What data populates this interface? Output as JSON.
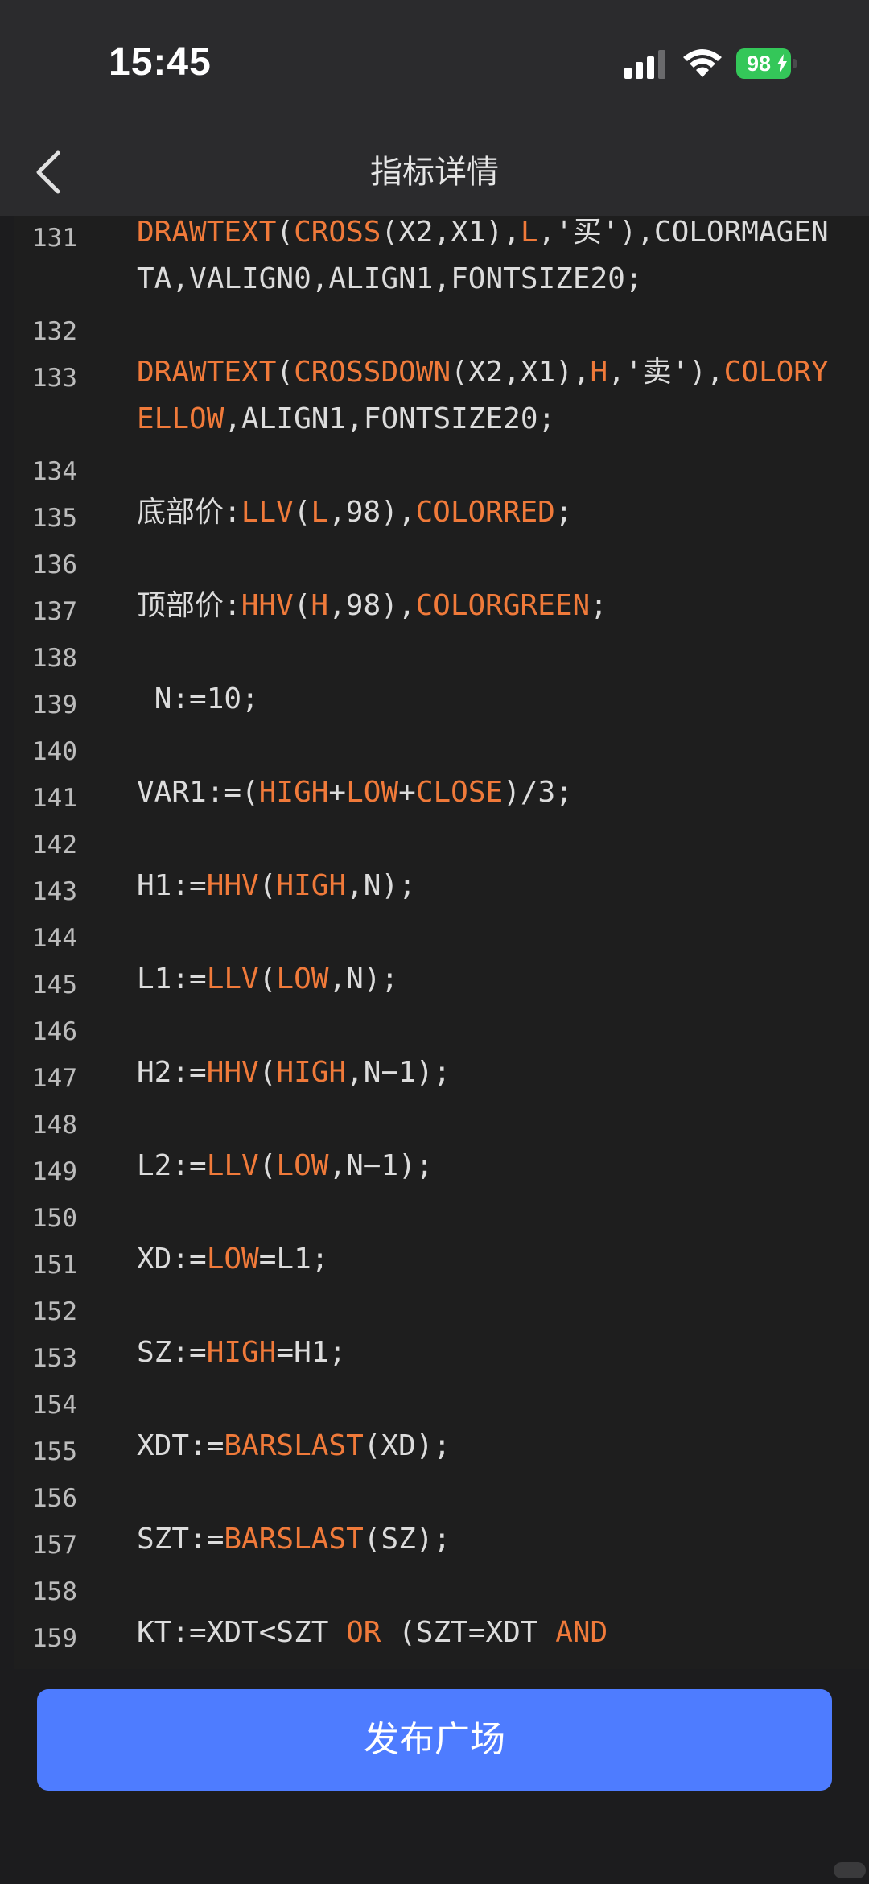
{
  "status_bar": {
    "time": "15:45",
    "battery_level": "98",
    "icons": [
      "signal-icon",
      "wifi-icon",
      "battery-icon",
      "charging-bolt-icon"
    ]
  },
  "nav": {
    "title": "指标详情",
    "back_icon": "chevron-left-icon"
  },
  "code": {
    "lines": [
      {
        "no": "131",
        "segments": [
          {
            "t": "DRAWTEXT",
            "k": 1
          },
          {
            "t": "("
          },
          {
            "t": "CROSS",
            "k": 1
          },
          {
            "t": "(X2,X1),"
          },
          {
            "t": "L",
            "k": 1
          },
          {
            "t": ",'买'),COLORMAGENTA,VALIGN0,ALIGN1,FONTSIZE20;"
          }
        ]
      },
      {
        "no": "132",
        "segments": []
      },
      {
        "no": "133",
        "segments": [
          {
            "t": "DRAWTEXT",
            "k": 1
          },
          {
            "t": "("
          },
          {
            "t": "CROSSDOWN",
            "k": 1
          },
          {
            "t": "(X2,X1),"
          },
          {
            "t": "H",
            "k": 1
          },
          {
            "t": ",'卖'),"
          },
          {
            "t": "COLORYELLOW",
            "k": 1
          },
          {
            "t": ",ALIGN1,FONTSIZE20;"
          }
        ]
      },
      {
        "no": "134",
        "segments": []
      },
      {
        "no": "135",
        "segments": [
          {
            "t": "底部价:"
          },
          {
            "t": "LLV",
            "k": 1
          },
          {
            "t": "("
          },
          {
            "t": "L",
            "k": 1
          },
          {
            "t": ",98),"
          },
          {
            "t": "COLORRED",
            "k": 1
          },
          {
            "t": ";"
          }
        ]
      },
      {
        "no": "136",
        "segments": []
      },
      {
        "no": "137",
        "segments": [
          {
            "t": "顶部价:"
          },
          {
            "t": "HHV",
            "k": 1
          },
          {
            "t": "("
          },
          {
            "t": "H",
            "k": 1
          },
          {
            "t": ",98),"
          },
          {
            "t": "COLORGREEN",
            "k": 1
          },
          {
            "t": ";"
          }
        ]
      },
      {
        "no": "138",
        "segments": []
      },
      {
        "no": "139",
        "segments": [
          {
            "t": " N:=10;"
          }
        ]
      },
      {
        "no": "140",
        "segments": []
      },
      {
        "no": "141",
        "segments": [
          {
            "t": "VAR1:=("
          },
          {
            "t": "HIGH",
            "k": 1
          },
          {
            "t": "+"
          },
          {
            "t": "LOW",
            "k": 1
          },
          {
            "t": "+"
          },
          {
            "t": "CLOSE",
            "k": 1
          },
          {
            "t": ")/3;"
          }
        ]
      },
      {
        "no": "142",
        "segments": []
      },
      {
        "no": "143",
        "segments": [
          {
            "t": "H1:="
          },
          {
            "t": "HHV",
            "k": 1
          },
          {
            "t": "("
          },
          {
            "t": "HIGH",
            "k": 1
          },
          {
            "t": ",N);"
          }
        ]
      },
      {
        "no": "144",
        "segments": []
      },
      {
        "no": "145",
        "segments": [
          {
            "t": "L1:="
          },
          {
            "t": "LLV",
            "k": 1
          },
          {
            "t": "("
          },
          {
            "t": "LOW",
            "k": 1
          },
          {
            "t": ",N);"
          }
        ]
      },
      {
        "no": "146",
        "segments": []
      },
      {
        "no": "147",
        "segments": [
          {
            "t": "H2:="
          },
          {
            "t": "HHV",
            "k": 1
          },
          {
            "t": "("
          },
          {
            "t": "HIGH",
            "k": 1
          },
          {
            "t": ",N−1);"
          }
        ]
      },
      {
        "no": "148",
        "segments": []
      },
      {
        "no": "149",
        "segments": [
          {
            "t": "L2:="
          },
          {
            "t": "LLV",
            "k": 1
          },
          {
            "t": "("
          },
          {
            "t": "LOW",
            "k": 1
          },
          {
            "t": ",N−1);"
          }
        ]
      },
      {
        "no": "150",
        "segments": []
      },
      {
        "no": "151",
        "segments": [
          {
            "t": "XD:="
          },
          {
            "t": "LOW",
            "k": 1
          },
          {
            "t": "=L1;"
          }
        ]
      },
      {
        "no": "152",
        "segments": []
      },
      {
        "no": "153",
        "segments": [
          {
            "t": "SZ:="
          },
          {
            "t": "HIGH",
            "k": 1
          },
          {
            "t": "=H1;"
          }
        ]
      },
      {
        "no": "154",
        "segments": []
      },
      {
        "no": "155",
        "segments": [
          {
            "t": "XDT:="
          },
          {
            "t": "BARSLAST",
            "k": 1
          },
          {
            "t": "(XD);"
          }
        ]
      },
      {
        "no": "156",
        "segments": []
      },
      {
        "no": "157",
        "segments": [
          {
            "t": "SZT:="
          },
          {
            "t": "BARSLAST",
            "k": 1
          },
          {
            "t": "(SZ);"
          }
        ]
      },
      {
        "no": "158",
        "segments": []
      },
      {
        "no": "159",
        "segments": [
          {
            "t": "KT:=XDT<SZT "
          },
          {
            "t": "OR",
            "k": 1
          },
          {
            "t": " (SZT=XDT "
          },
          {
            "t": "AND",
            "k": 1
          }
        ]
      }
    ]
  },
  "footer": {
    "publish_label": "发布广场"
  },
  "colors": {
    "keyword": "#f07a3a",
    "text": "#dcdcdc",
    "button": "#4e7cff",
    "battery": "#34c759"
  }
}
